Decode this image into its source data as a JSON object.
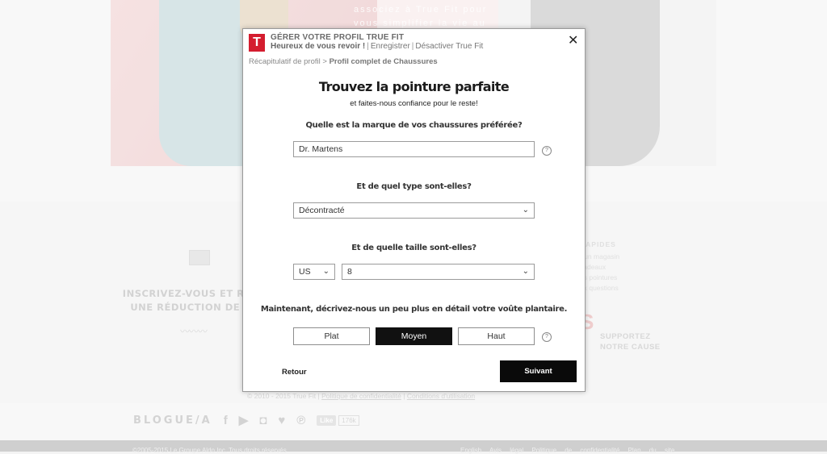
{
  "background": {
    "hero_text": [
      "associez à True Fit pour",
      "vous simplifier la vie au"
    ],
    "newsletter_text": [
      "INSCRIVEZ-VOUS ET RECE",
      "UNE RÉDUCTION DE 15"
    ],
    "zigzag": "〰〰〰",
    "quicklinks": {
      "heading": "RAPIDES",
      "items": [
        "r un magasin",
        "cadeaux",
        "es pointures",
        "ux questions"
      ]
    },
    "support": [
      "SUPPORTEZ",
      "NOTRE CAUSE"
    ],
    "support_letter": "S",
    "copyright": "© 2010 - 2015 True Fit",
    "privacy_link": "Politique de confidentialité",
    "terms_link": "Conditions d'utilisation",
    "social": {
      "blog": "BLOGUE/A",
      "like_label": "Like",
      "like_count": "176k"
    },
    "footer": {
      "left": "©2005-2015 Le Groupe Aldo Inc. Tous droits réservés",
      "right": "English  Avis légal  Politique de confidentialité  Plan du site"
    }
  },
  "modal": {
    "logo": "T",
    "header_title": "GÉRER VOTRE PROFIL TRUE FIT",
    "greeting": "Heureux de vous revoir !",
    "save_link": "Enregistrer",
    "deactivate_link": "Désactiver True Fit",
    "breadcrumb": {
      "first": "Récapitulatif de profil",
      "arrow": ">",
      "current": "Profil complet de Chaussures"
    },
    "heading": "Trouvez la pointure parfaite",
    "subheading": "et faites-nous confiance pour le reste!",
    "brand_question": "Quelle est la marque de vos chaussures préférée?",
    "brand_value": "Dr. Martens",
    "type_question": "Et de quel type sont-elles?",
    "type_value": "Décontracté",
    "size_question": "Et de quelle taille sont-elles?",
    "size_system": "US",
    "size_value": "8",
    "arch_question": "Maintenant, décrivez-nous un peu plus en détail votre voûte plantaire.",
    "arch_options": [
      "Plat",
      "Moyen",
      "Haut"
    ],
    "arch_selected": "Moyen",
    "back_label": "Retour",
    "next_label": "Suivant",
    "help_glyph": "?",
    "close_glyph": "✕",
    "chevron_glyph": "⌄"
  }
}
